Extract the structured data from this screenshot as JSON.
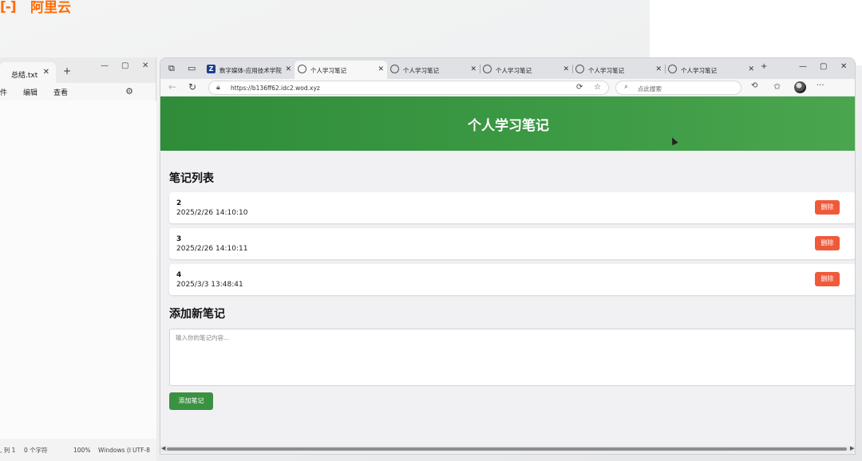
{
  "brand": {
    "logo_text": "阿里云",
    "logo_mark": "[-]",
    "color": "#ff6a00"
  },
  "notepad": {
    "tab_title": "总结.txt",
    "menu": [
      "件",
      "编辑",
      "查看"
    ],
    "status": {
      "position": ", 列 1",
      "chars": "0 个字符",
      "zoom": "100%",
      "line_ending": "Windows (I",
      "encoding": "UTF-8"
    }
  },
  "browser": {
    "tabs": [
      {
        "label": "数字媒体-应用技术学院",
        "active": false
      },
      {
        "label": "个人学习笔记",
        "active": true
      },
      {
        "label": "个人学习笔记",
        "active": false
      },
      {
        "label": "个人学习笔记",
        "active": false
      },
      {
        "label": "个人学习笔记",
        "active": false
      },
      {
        "label": "个人学习笔记",
        "active": false
      }
    ],
    "url": "https://b136ff62.idc2.wod.xyz",
    "search_placeholder": "点此搜索"
  },
  "page": {
    "title": "个人学习笔记",
    "list_heading": "笔记列表",
    "notes": [
      {
        "name": "2",
        "time": "2025/2/26 14:10:10"
      },
      {
        "name": "3",
        "time": "2025/2/26 14:10:11"
      },
      {
        "name": "4",
        "time": "2025/3/3 13:48:41"
      }
    ],
    "delete_label": "删除",
    "add_heading": "添加新笔记",
    "input_placeholder": "输入你的笔记内容...",
    "add_button": "添加笔记",
    "header_color": "#3a9142",
    "delete_color": "#ef5a3a"
  }
}
